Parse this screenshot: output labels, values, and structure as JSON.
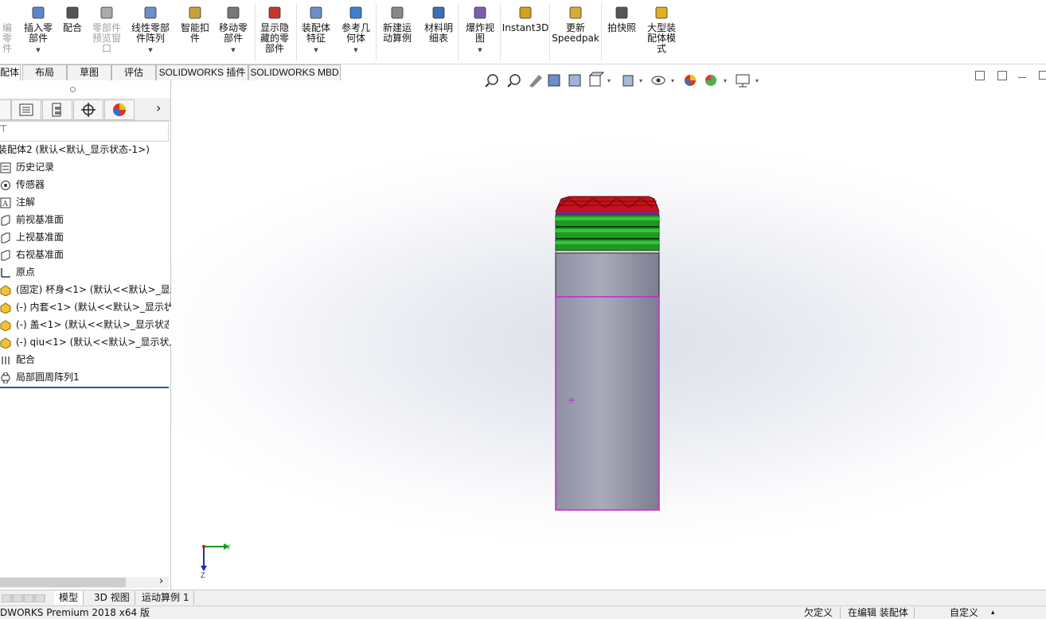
{
  "ribbon": {
    "buttons": [
      {
        "label": "插入零\n部件",
        "icon": "insert-component-icon"
      },
      {
        "label": "配合",
        "icon": "mate-icon"
      },
      {
        "label": "零部件\n预览窗\n口",
        "icon": "component-preview-icon"
      },
      {
        "label": "线性零部\n件阵列",
        "icon": "linear-pattern-icon"
      },
      {
        "label": "智能扣\n件",
        "icon": "smart-fastener-icon"
      },
      {
        "label": "移动零\n部件",
        "icon": "move-component-icon"
      },
      {
        "label": "显示隐\n藏的零\n部件",
        "icon": "show-hidden-icon"
      },
      {
        "label": "装配体\n特征",
        "icon": "assembly-feature-icon"
      },
      {
        "label": "参考几\n何体",
        "icon": "reference-geometry-icon"
      },
      {
        "label": "新建运\n动算例",
        "icon": "motion-study-icon"
      },
      {
        "label": "材料明\n细表",
        "icon": "bom-icon"
      },
      {
        "label": "爆炸视\n图",
        "icon": "exploded-view-icon"
      },
      {
        "label": "Instant3D",
        "icon": "instant3d-icon"
      },
      {
        "label": "更新\nSpeedpak",
        "icon": "speedpak-icon"
      },
      {
        "label": "拍快照",
        "icon": "snapshot-icon"
      },
      {
        "label": "大型装\n配体模\n式",
        "icon": "large-assembly-icon"
      }
    ],
    "cutoff_label": "编零\n件"
  },
  "tabs": [
    "配体",
    "布局",
    "草图",
    "评估",
    "SOLIDWORKS 插件",
    "SOLIDWORKS MBD"
  ],
  "feature_tree": {
    "root": "装配体2 (默认<默认_显示状态-1>)",
    "items": [
      {
        "label": "历史记录",
        "icon": "history-icon"
      },
      {
        "label": "传感器",
        "icon": "sensor-icon"
      },
      {
        "label": "注解",
        "icon": "annotation-icon"
      },
      {
        "label": "前视基准面",
        "icon": "plane-icon"
      },
      {
        "label": "上视基准面",
        "icon": "plane-icon"
      },
      {
        "label": "右视基准面",
        "icon": "plane-icon"
      },
      {
        "label": "原点",
        "icon": "origin-icon"
      },
      {
        "label": "(固定) 杯身<1> (默认<<默认>_显示",
        "icon": "part-icon"
      },
      {
        "label": "(-) 内套<1> (默认<<默认>_显示状态",
        "icon": "part-icon"
      },
      {
        "label": "(-) 盖<1> (默认<<默认>_显示状态",
        "icon": "part-icon"
      },
      {
        "label": "(-) qiu<1> (默认<<默认>_显示状态",
        "icon": "part-icon"
      },
      {
        "label": "配合",
        "icon": "mates-folder-icon"
      },
      {
        "label": "局部圆周阵列1",
        "icon": "circular-pattern-icon"
      }
    ]
  },
  "bottom_tabs": [
    "模型",
    "3D 视图",
    "运动算例 1"
  ],
  "status": {
    "product": "DWORKS Premium 2018 x64 版",
    "defined": "欠定义",
    "editing": "在编辑 装配体",
    "units": "自定义"
  },
  "triad": {
    "x_label": "Y",
    "z_label": "Z"
  },
  "colors": {
    "cap_red": "#c4131b",
    "band_green": "#1e9a22",
    "body_gray": "#9a9cae",
    "selection_magenta": "#d21ed2"
  }
}
